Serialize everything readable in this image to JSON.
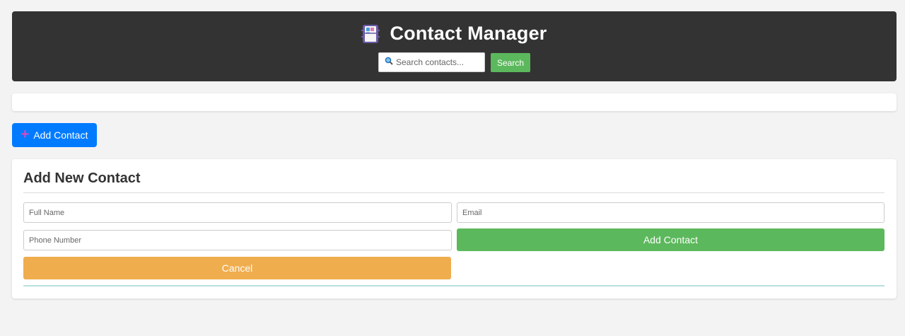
{
  "header": {
    "app_icon": "address-book-icon",
    "title": "Contact Manager",
    "search": {
      "icon": "magnifier-icon",
      "placeholder": "Search contacts...",
      "value": "",
      "button_label": "Search"
    }
  },
  "toolbar": {
    "add_contact_label": "Add Contact",
    "add_icon": "plus-icon"
  },
  "form": {
    "heading": "Add New Contact",
    "fields": {
      "full_name_placeholder": "Full Name",
      "email_placeholder": "Email",
      "phone_placeholder": "Phone Number"
    },
    "submit_label": "Add Contact",
    "cancel_label": "Cancel"
  },
  "colors": {
    "header_bg": "#333333",
    "primary": "#007bff",
    "success": "#5cb85c",
    "warning": "#f0ad4e"
  }
}
